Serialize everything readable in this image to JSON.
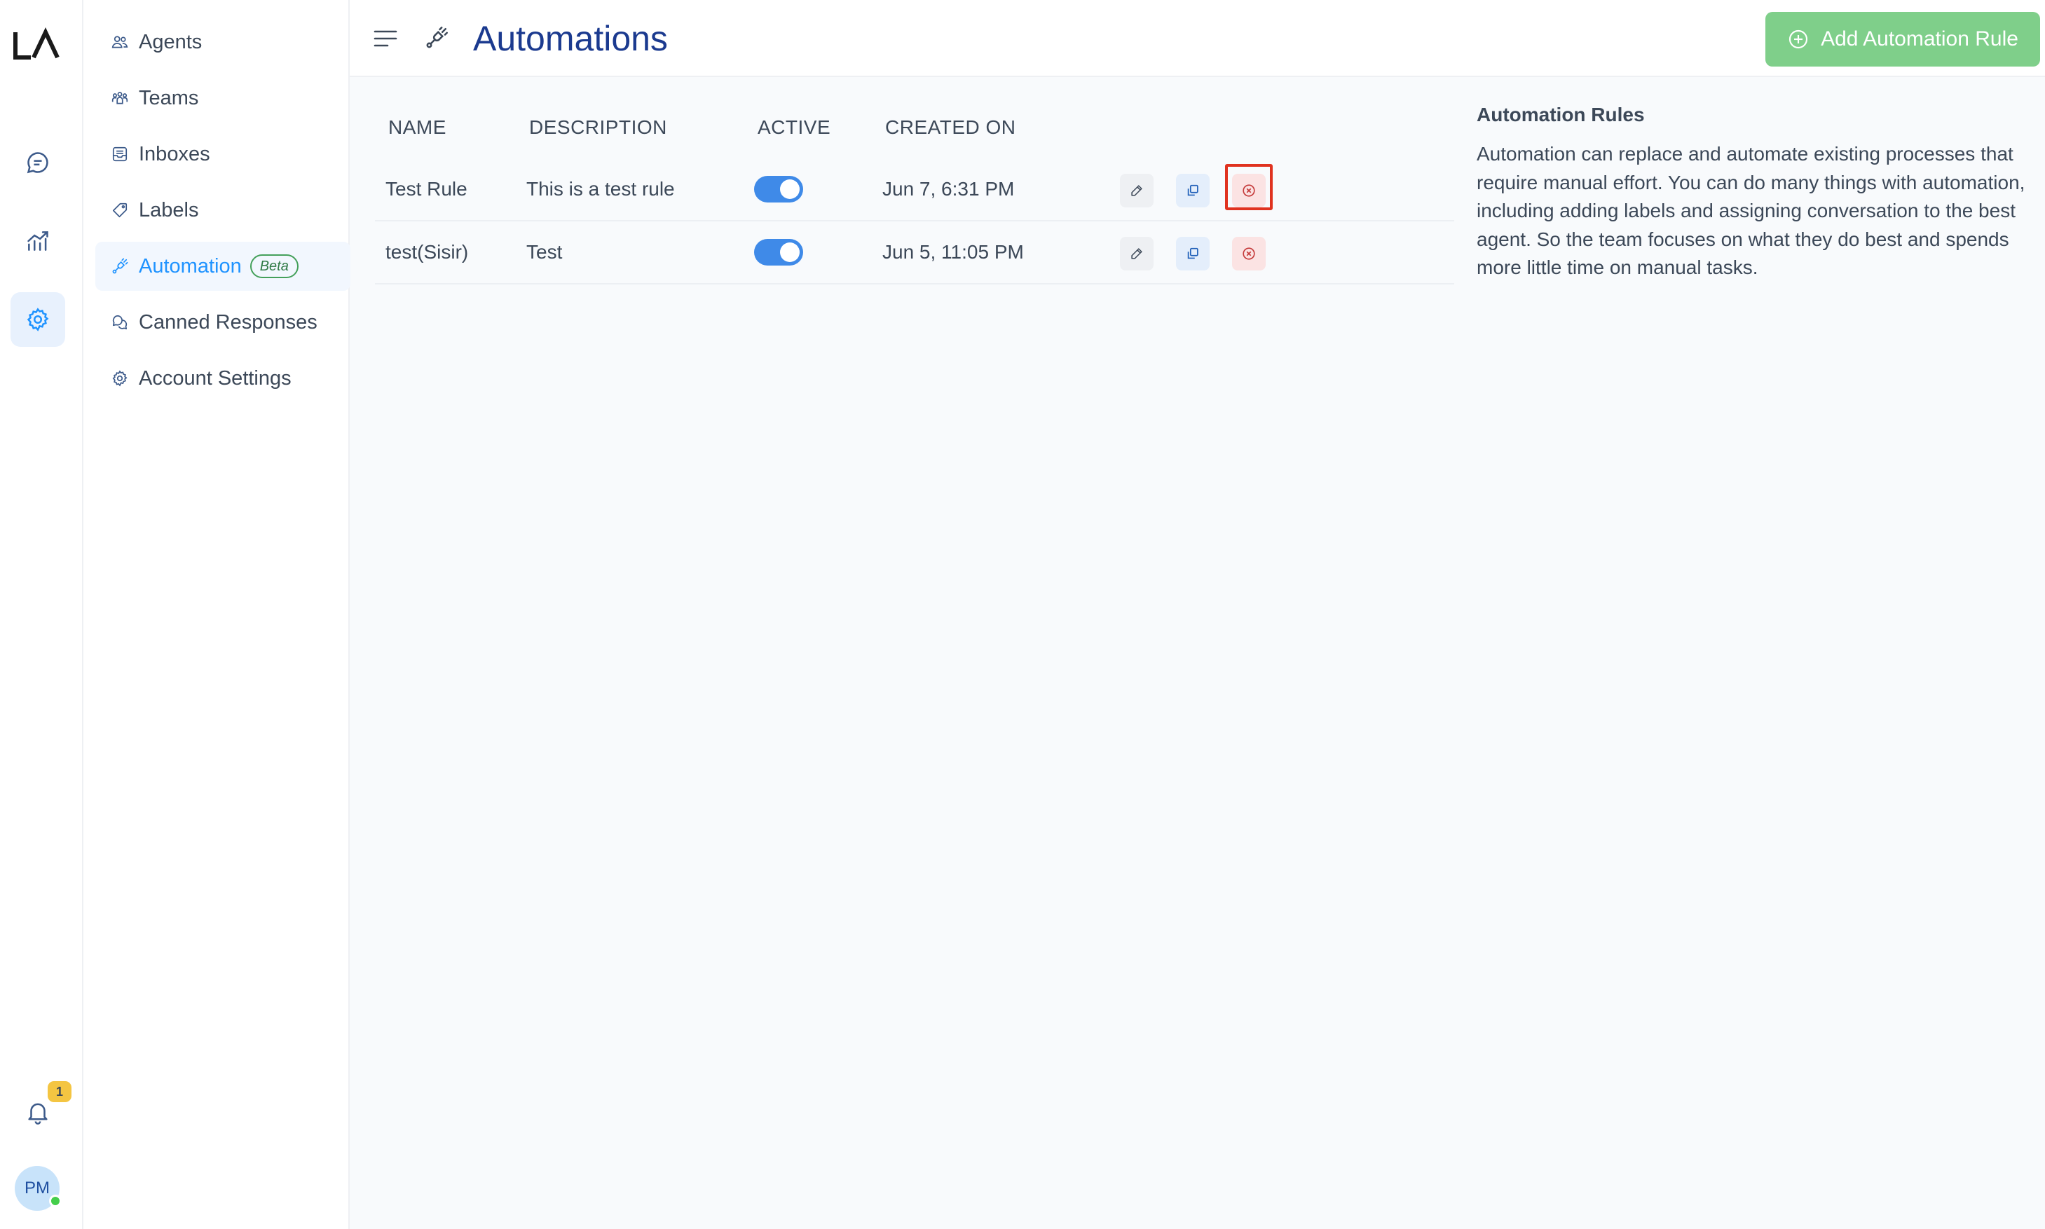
{
  "rail": {
    "logo_text": "LA",
    "items": [
      {
        "name": "conversations",
        "icon": "chat-bubble-icon"
      },
      {
        "name": "reports",
        "icon": "chart-trend-icon"
      },
      {
        "name": "settings",
        "icon": "gear-icon",
        "active": true
      }
    ],
    "notifications": {
      "icon": "bell-icon",
      "count": "1"
    },
    "user": {
      "initials": "PM",
      "status": "online"
    }
  },
  "sidebar": {
    "items": [
      {
        "label": "Agents",
        "icon": "people-icon"
      },
      {
        "label": "Teams",
        "icon": "team-icon"
      },
      {
        "label": "Inboxes",
        "icon": "inbox-icon"
      },
      {
        "label": "Labels",
        "icon": "tag-icon"
      },
      {
        "label": "Automation",
        "icon": "automation-icon",
        "badge": "Beta",
        "active": true
      },
      {
        "label": "Canned Responses",
        "icon": "chat-multiple-icon"
      },
      {
        "label": "Account Settings",
        "icon": "gear-icon"
      }
    ]
  },
  "header": {
    "title": "Automations",
    "add_button_label": "Add Automation Rule"
  },
  "table": {
    "columns": [
      "NAME",
      "DESCRIPTION",
      "ACTIVE",
      "CREATED ON"
    ],
    "rows": [
      {
        "name": "Test Rule",
        "description": "This is a test rule",
        "active": true,
        "created_on": "Jun 7, 6:31 PM"
      },
      {
        "name": "test(Sisir)",
        "description": "Test",
        "active": true,
        "created_on": "Jun 5, 11:05 PM"
      }
    ]
  },
  "info": {
    "title": "Automation Rules",
    "body": "Automation can replace and automate existing processes that require manual effort. You can do many things with automation, including adding labels and assigning conversation to the best agent. So the team focuses on what they do best and spends more little time on manual tasks."
  },
  "colors": {
    "accent": "#1f93ff",
    "title": "#1b3a8f",
    "add_button": "#7fcf8a",
    "toggle_on": "#3f8ae8",
    "delete_bg": "#fbe3e3",
    "focus_outline": "#e0321f"
  }
}
